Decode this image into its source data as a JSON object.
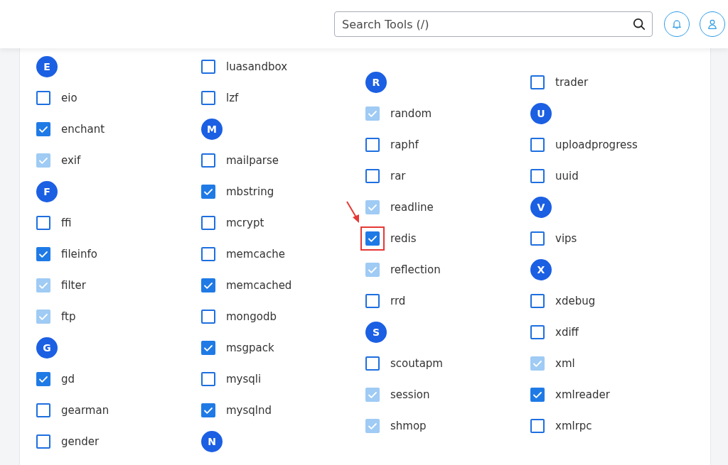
{
  "search": {
    "placeholder": "Search Tools (/)"
  },
  "columns": [
    {
      "items": [
        {
          "kind": "letter",
          "label": "E"
        },
        {
          "kind": "extension",
          "label": "eio",
          "checked": false,
          "disabled": false
        },
        {
          "kind": "extension",
          "label": "enchant",
          "checked": true,
          "disabled": false
        },
        {
          "kind": "extension",
          "label": "exif",
          "checked": true,
          "disabled": true
        },
        {
          "kind": "letter",
          "label": "F"
        },
        {
          "kind": "extension",
          "label": "ffi",
          "checked": false,
          "disabled": false
        },
        {
          "kind": "extension",
          "label": "fileinfo",
          "checked": true,
          "disabled": false
        },
        {
          "kind": "extension",
          "label": "filter",
          "checked": true,
          "disabled": true
        },
        {
          "kind": "extension",
          "label": "ftp",
          "checked": true,
          "disabled": true
        },
        {
          "kind": "letter",
          "label": "G"
        },
        {
          "kind": "extension",
          "label": "gd",
          "checked": true,
          "disabled": false
        },
        {
          "kind": "extension",
          "label": "gearman",
          "checked": false,
          "disabled": false
        },
        {
          "kind": "extension",
          "label": "gender",
          "checked": false,
          "disabled": false
        }
      ]
    },
    {
      "items": [
        {
          "kind": "extension",
          "label": "luasandbox",
          "checked": false,
          "disabled": false
        },
        {
          "kind": "extension",
          "label": "lzf",
          "checked": false,
          "disabled": false
        },
        {
          "kind": "letter",
          "label": "M"
        },
        {
          "kind": "extension",
          "label": "mailparse",
          "checked": false,
          "disabled": false
        },
        {
          "kind": "extension",
          "label": "mbstring",
          "checked": true,
          "disabled": false
        },
        {
          "kind": "extension",
          "label": "mcrypt",
          "checked": false,
          "disabled": false
        },
        {
          "kind": "extension",
          "label": "memcache",
          "checked": false,
          "disabled": false
        },
        {
          "kind": "extension",
          "label": "memcached",
          "checked": true,
          "disabled": false
        },
        {
          "kind": "extension",
          "label": "mongodb",
          "checked": false,
          "disabled": false
        },
        {
          "kind": "extension",
          "label": "msgpack",
          "checked": true,
          "disabled": false
        },
        {
          "kind": "extension",
          "label": "mysqli",
          "checked": false,
          "disabled": false
        },
        {
          "kind": "extension",
          "label": "mysqlnd",
          "checked": true,
          "disabled": false
        },
        {
          "kind": "letter",
          "label": "N"
        }
      ]
    },
    {
      "items": [
        {
          "kind": "letter",
          "label": "R"
        },
        {
          "kind": "extension",
          "label": "random",
          "checked": true,
          "disabled": true
        },
        {
          "kind": "extension",
          "label": "raphf",
          "checked": false,
          "disabled": false
        },
        {
          "kind": "extension",
          "label": "rar",
          "checked": false,
          "disabled": false
        },
        {
          "kind": "extension",
          "label": "readline",
          "checked": true,
          "disabled": true
        },
        {
          "kind": "extension",
          "label": "redis",
          "checked": true,
          "disabled": false,
          "highlighted": true
        },
        {
          "kind": "extension",
          "label": "reflection",
          "checked": true,
          "disabled": true
        },
        {
          "kind": "extension",
          "label": "rrd",
          "checked": false,
          "disabled": false
        },
        {
          "kind": "letter",
          "label": "S"
        },
        {
          "kind": "extension",
          "label": "scoutapm",
          "checked": false,
          "disabled": false
        },
        {
          "kind": "extension",
          "label": "session",
          "checked": true,
          "disabled": true
        },
        {
          "kind": "extension",
          "label": "shmop",
          "checked": true,
          "disabled": true
        }
      ]
    },
    {
      "items": [
        {
          "kind": "extension",
          "label": "trader",
          "checked": false,
          "disabled": false
        },
        {
          "kind": "letter",
          "label": "U"
        },
        {
          "kind": "extension",
          "label": "uploadprogress",
          "checked": false,
          "disabled": false
        },
        {
          "kind": "extension",
          "label": "uuid",
          "checked": false,
          "disabled": false
        },
        {
          "kind": "letter",
          "label": "V"
        },
        {
          "kind": "extension",
          "label": "vips",
          "checked": false,
          "disabled": false
        },
        {
          "kind": "letter",
          "label": "X"
        },
        {
          "kind": "extension",
          "label": "xdebug",
          "checked": false,
          "disabled": false
        },
        {
          "kind": "extension",
          "label": "xdiff",
          "checked": false,
          "disabled": false
        },
        {
          "kind": "extension",
          "label": "xml",
          "checked": true,
          "disabled": true
        },
        {
          "kind": "extension",
          "label": "xmlreader",
          "checked": true,
          "disabled": false
        },
        {
          "kind": "extension",
          "label": "xmlrpc",
          "checked": false,
          "disabled": false
        }
      ]
    }
  ]
}
